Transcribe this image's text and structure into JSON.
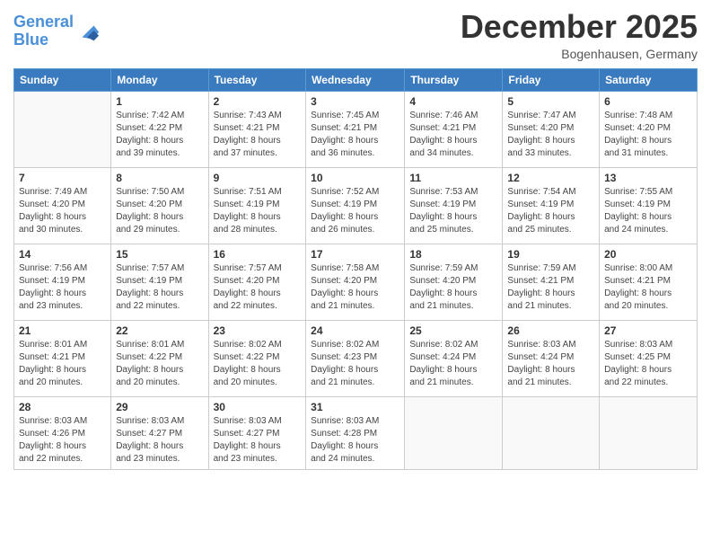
{
  "header": {
    "logo_line1": "General",
    "logo_line2": "Blue",
    "month_title": "December 2025",
    "subtitle": "Bogenhausen, Germany"
  },
  "days_of_week": [
    "Sunday",
    "Monday",
    "Tuesday",
    "Wednesday",
    "Thursday",
    "Friday",
    "Saturday"
  ],
  "weeks": [
    [
      {
        "day": "",
        "info": ""
      },
      {
        "day": "1",
        "info": "Sunrise: 7:42 AM\nSunset: 4:22 PM\nDaylight: 8 hours\nand 39 minutes."
      },
      {
        "day": "2",
        "info": "Sunrise: 7:43 AM\nSunset: 4:21 PM\nDaylight: 8 hours\nand 37 minutes."
      },
      {
        "day": "3",
        "info": "Sunrise: 7:45 AM\nSunset: 4:21 PM\nDaylight: 8 hours\nand 36 minutes."
      },
      {
        "day": "4",
        "info": "Sunrise: 7:46 AM\nSunset: 4:21 PM\nDaylight: 8 hours\nand 34 minutes."
      },
      {
        "day": "5",
        "info": "Sunrise: 7:47 AM\nSunset: 4:20 PM\nDaylight: 8 hours\nand 33 minutes."
      },
      {
        "day": "6",
        "info": "Sunrise: 7:48 AM\nSunset: 4:20 PM\nDaylight: 8 hours\nand 31 minutes."
      }
    ],
    [
      {
        "day": "7",
        "info": "Sunrise: 7:49 AM\nSunset: 4:20 PM\nDaylight: 8 hours\nand 30 minutes."
      },
      {
        "day": "8",
        "info": "Sunrise: 7:50 AM\nSunset: 4:20 PM\nDaylight: 8 hours\nand 29 minutes."
      },
      {
        "day": "9",
        "info": "Sunrise: 7:51 AM\nSunset: 4:19 PM\nDaylight: 8 hours\nand 28 minutes."
      },
      {
        "day": "10",
        "info": "Sunrise: 7:52 AM\nSunset: 4:19 PM\nDaylight: 8 hours\nand 26 minutes."
      },
      {
        "day": "11",
        "info": "Sunrise: 7:53 AM\nSunset: 4:19 PM\nDaylight: 8 hours\nand 25 minutes."
      },
      {
        "day": "12",
        "info": "Sunrise: 7:54 AM\nSunset: 4:19 PM\nDaylight: 8 hours\nand 25 minutes."
      },
      {
        "day": "13",
        "info": "Sunrise: 7:55 AM\nSunset: 4:19 PM\nDaylight: 8 hours\nand 24 minutes."
      }
    ],
    [
      {
        "day": "14",
        "info": "Sunrise: 7:56 AM\nSunset: 4:19 PM\nDaylight: 8 hours\nand 23 minutes."
      },
      {
        "day": "15",
        "info": "Sunrise: 7:57 AM\nSunset: 4:19 PM\nDaylight: 8 hours\nand 22 minutes."
      },
      {
        "day": "16",
        "info": "Sunrise: 7:57 AM\nSunset: 4:20 PM\nDaylight: 8 hours\nand 22 minutes."
      },
      {
        "day": "17",
        "info": "Sunrise: 7:58 AM\nSunset: 4:20 PM\nDaylight: 8 hours\nand 21 minutes."
      },
      {
        "day": "18",
        "info": "Sunrise: 7:59 AM\nSunset: 4:20 PM\nDaylight: 8 hours\nand 21 minutes."
      },
      {
        "day": "19",
        "info": "Sunrise: 7:59 AM\nSunset: 4:21 PM\nDaylight: 8 hours\nand 21 minutes."
      },
      {
        "day": "20",
        "info": "Sunrise: 8:00 AM\nSunset: 4:21 PM\nDaylight: 8 hours\nand 20 minutes."
      }
    ],
    [
      {
        "day": "21",
        "info": "Sunrise: 8:01 AM\nSunset: 4:21 PM\nDaylight: 8 hours\nand 20 minutes."
      },
      {
        "day": "22",
        "info": "Sunrise: 8:01 AM\nSunset: 4:22 PM\nDaylight: 8 hours\nand 20 minutes."
      },
      {
        "day": "23",
        "info": "Sunrise: 8:02 AM\nSunset: 4:22 PM\nDaylight: 8 hours\nand 20 minutes."
      },
      {
        "day": "24",
        "info": "Sunrise: 8:02 AM\nSunset: 4:23 PM\nDaylight: 8 hours\nand 21 minutes."
      },
      {
        "day": "25",
        "info": "Sunrise: 8:02 AM\nSunset: 4:24 PM\nDaylight: 8 hours\nand 21 minutes."
      },
      {
        "day": "26",
        "info": "Sunrise: 8:03 AM\nSunset: 4:24 PM\nDaylight: 8 hours\nand 21 minutes."
      },
      {
        "day": "27",
        "info": "Sunrise: 8:03 AM\nSunset: 4:25 PM\nDaylight: 8 hours\nand 22 minutes."
      }
    ],
    [
      {
        "day": "28",
        "info": "Sunrise: 8:03 AM\nSunset: 4:26 PM\nDaylight: 8 hours\nand 22 minutes."
      },
      {
        "day": "29",
        "info": "Sunrise: 8:03 AM\nSunset: 4:27 PM\nDaylight: 8 hours\nand 23 minutes."
      },
      {
        "day": "30",
        "info": "Sunrise: 8:03 AM\nSunset: 4:27 PM\nDaylight: 8 hours\nand 23 minutes."
      },
      {
        "day": "31",
        "info": "Sunrise: 8:03 AM\nSunset: 4:28 PM\nDaylight: 8 hours\nand 24 minutes."
      },
      {
        "day": "",
        "info": ""
      },
      {
        "day": "",
        "info": ""
      },
      {
        "day": "",
        "info": ""
      }
    ]
  ]
}
